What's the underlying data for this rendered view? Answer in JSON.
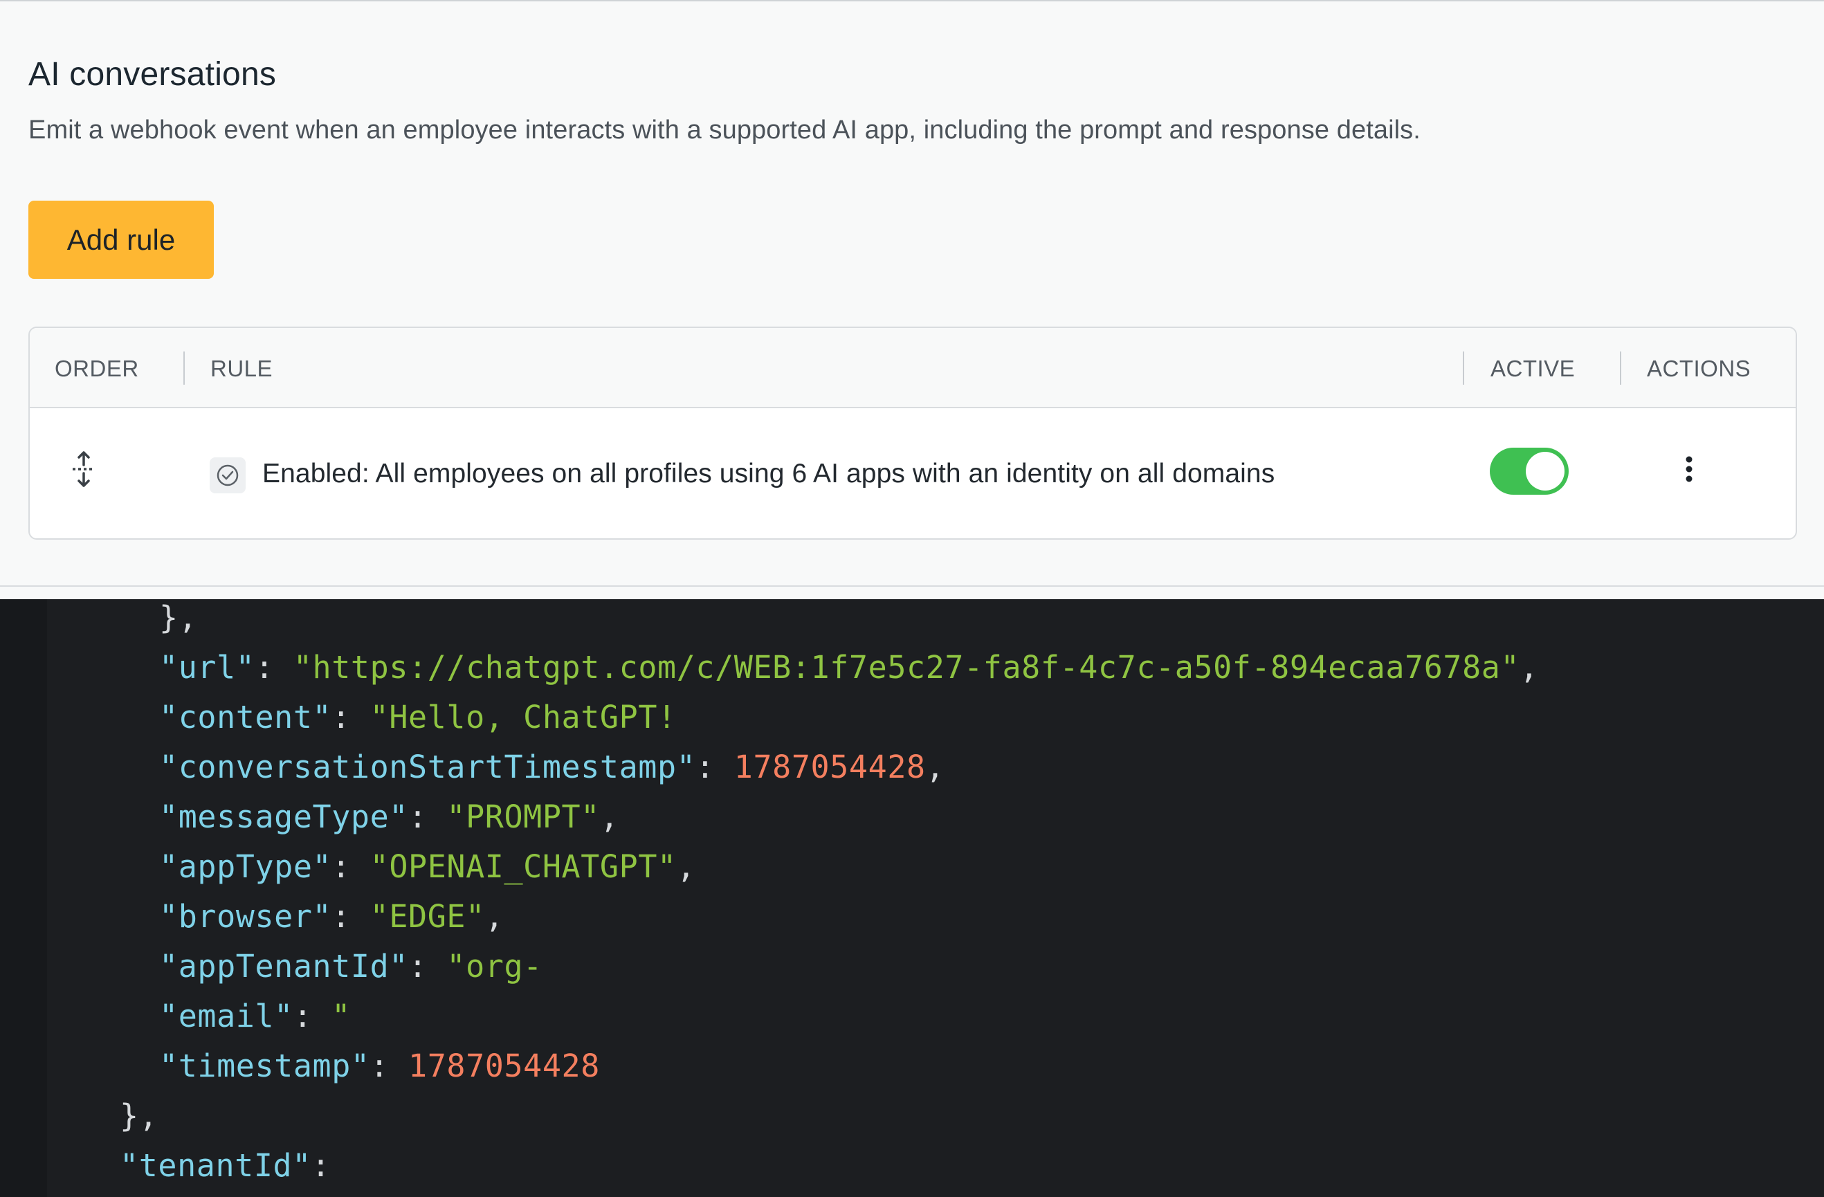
{
  "section": {
    "title": "AI conversations",
    "description": "Emit a webhook event when an employee interacts with a supported AI app, including the prompt and response details."
  },
  "add_rule_label": "Add rule",
  "table": {
    "headers": [
      "ORDER",
      "RULE",
      "ACTIVE",
      "ACTIONS"
    ],
    "rows": [
      {
        "rule": "Enabled: All employees on all profiles using 6 AI apps with an identity on all domains",
        "active": true
      }
    ]
  },
  "icons": {
    "drag": "drag-handle-icon",
    "status": "check-circle-icon",
    "actions": "more-vertical-icon"
  },
  "colors": {
    "accent": "#feb732",
    "toggle_on": "#3fc052",
    "code_bg": "#1c1e21",
    "code_key": "#7fd2e8",
    "code_string": "#8fc442",
    "code_number": "#f47f5f"
  },
  "code": {
    "close_obj_1": "},",
    "url_key": "\"url\"",
    "url_val": "\"https://chatgpt.com/c/WEB:1f7e5c27-fa8f-4c7c-a50f-894ecaa7678a\"",
    "content_key": "\"content\"",
    "content_val": "\"Hello, ChatGPT!",
    "cst_key": "\"conversationStartTimestamp\"",
    "cst_val": "1787054428",
    "mt_key": "\"messageType\"",
    "mt_val": "\"PROMPT\"",
    "at_key": "\"appType\"",
    "at_val": "\"OPENAI_CHATGPT\"",
    "br_key": "\"browser\"",
    "br_val": "\"EDGE\"",
    "ati_key": "\"appTenantId\"",
    "ati_val": "\"org-",
    "email_key": "\"email\"",
    "email_val": "\"",
    "ts_key": "\"timestamp\"",
    "ts_val": "1787054428",
    "close_obj_2": "},",
    "tenant_key": "\"tenantId\"",
    "colon": ": ",
    "colon_end": ":",
    "comma": ","
  }
}
